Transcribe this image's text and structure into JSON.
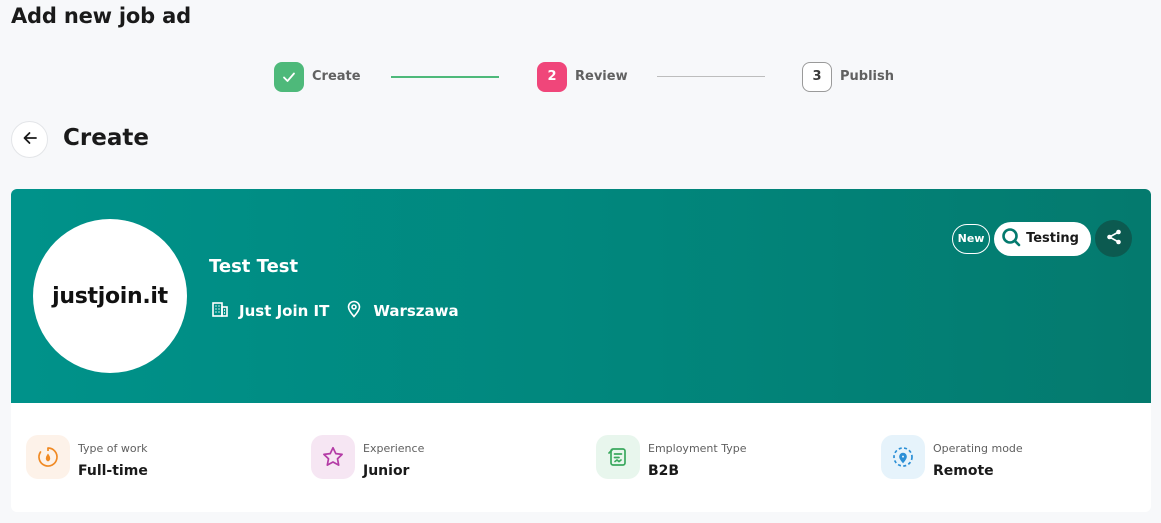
{
  "page": {
    "title": "Add new job ad"
  },
  "stepper": {
    "steps": [
      {
        "number": "1",
        "label": "Create",
        "state": "completed",
        "icon": "check-icon"
      },
      {
        "number": "2",
        "label": "Review",
        "state": "active"
      },
      {
        "number": "3",
        "label": "Publish",
        "state": "pending"
      }
    ]
  },
  "section": {
    "title": "Create",
    "back_icon": "arrow-left-icon"
  },
  "card": {
    "logo_text": "justjoin.it",
    "job_title": "Test Test",
    "company": "Just Join IT",
    "company_icon": "building-icon",
    "location": "Warszawa",
    "location_icon": "map-pin-icon",
    "badges": {
      "new": "New",
      "category": "Testing",
      "category_icon": "magnifier-icon"
    },
    "share_icon": "share-icon",
    "details": [
      {
        "label": "Type of work",
        "value": "Full-time",
        "icon": "timer-icon",
        "color": "#f08a24"
      },
      {
        "label": "Experience",
        "value": "Junior",
        "icon": "star-icon",
        "color": "#b43ca6"
      },
      {
        "label": "Employment Type",
        "value": "B2B",
        "icon": "contract-icon",
        "color": "#3aa85e"
      },
      {
        "label": "Operating mode",
        "value": "Remote",
        "icon": "location-dashed-icon",
        "color": "#2b8fd6"
      }
    ]
  },
  "colors": {
    "banner": "#00928a",
    "step_done": "#4eb97a",
    "step_active": "#f0467a",
    "share_bg": "#0c5a50"
  }
}
